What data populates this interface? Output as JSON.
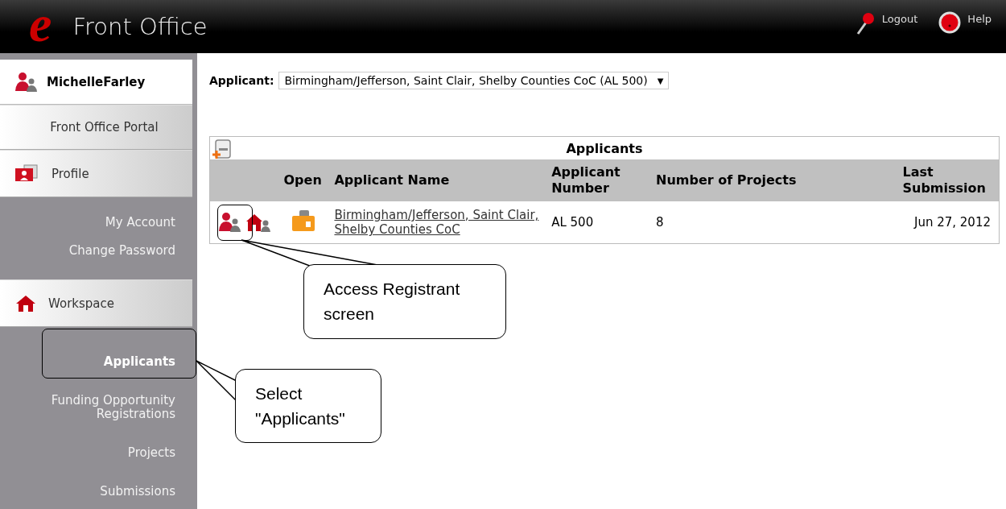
{
  "header": {
    "logo_letter": "e",
    "title": "Front Office",
    "links": [
      {
        "kind": "logout",
        "label": "Logout"
      },
      {
        "kind": "help",
        "label": "Help"
      }
    ]
  },
  "sidebar": [
    {
      "kind": "user",
      "label": "MichelleFarley"
    },
    {
      "kind": "link",
      "label": "Front Office Portal"
    },
    {
      "kind": "profile",
      "label": "Profile",
      "children": [
        {
          "label": "My Account",
          "selected": false
        },
        {
          "label": "Change Password",
          "selected": false
        }
      ]
    },
    {
      "kind": "workspace",
      "label": "Workspace",
      "children": [
        {
          "label": "Applicants",
          "selected": true
        },
        {
          "label": "Funding Opportunity Registrations",
          "selected": false
        },
        {
          "label": "Projects",
          "selected": false
        },
        {
          "label": "Submissions",
          "selected": false
        }
      ]
    }
  ],
  "applicant_select": {
    "label": "Applicant:",
    "value": "Birmingham/Jefferson, Saint Clair, Shelby Counties CoC (AL 500)",
    "arrow": "▼"
  },
  "table": {
    "title": "Applicants",
    "columns": [
      "",
      "Open",
      "Applicant Name",
      "Applicant Number",
      "Number of Projects",
      "Last Submission"
    ],
    "rows": [
      {
        "name": "Birmingham/Jefferson, Saint Clair, Shelby Counties CoC",
        "number": "AL 500",
        "projects": "8",
        "last_submission": "Jun 27, 2012"
      }
    ]
  },
  "callouts": [
    {
      "text": "Access Registrant screen"
    },
    {
      "text": "Select \"Applicants\""
    }
  ]
}
